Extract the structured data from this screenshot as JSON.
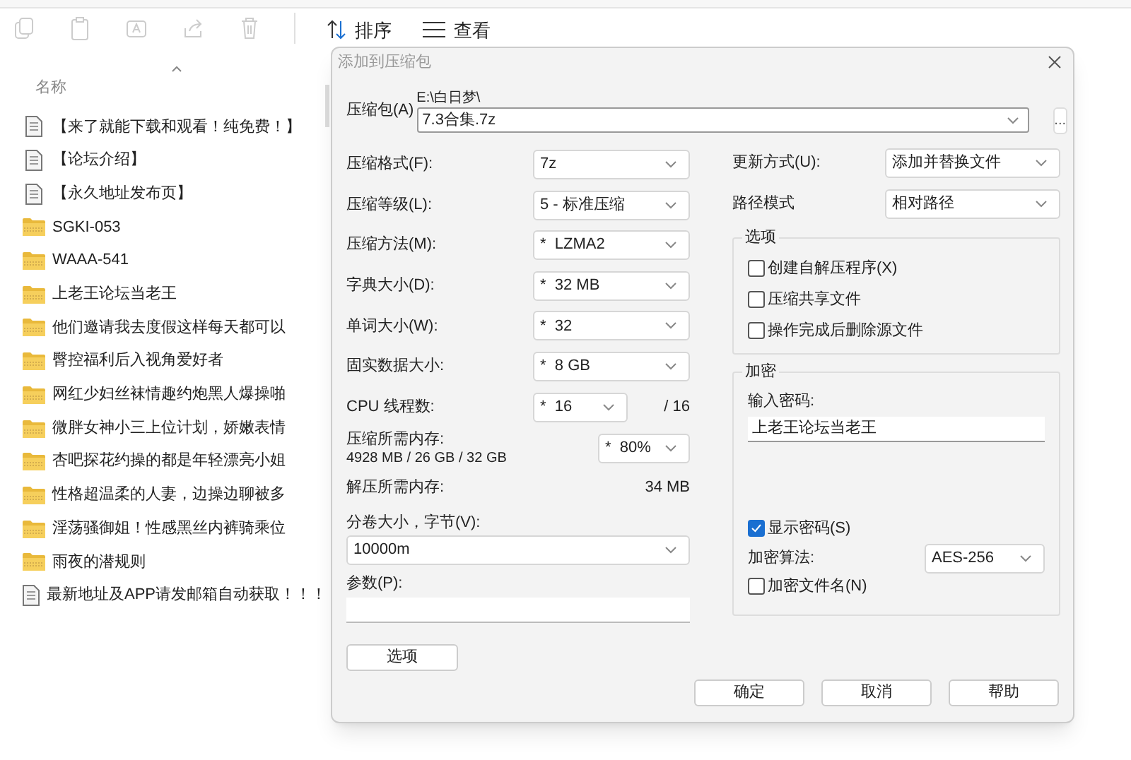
{
  "explorer": {
    "toolbar": [
      {
        "label": "排序"
      },
      {
        "label": "查看"
      }
    ],
    "column_header": "名称",
    "files": [
      {
        "name": "【来了就能下载和观看！纯免费！】",
        "kind": "document"
      },
      {
        "name": "【论坛介绍】",
        "kind": "document"
      },
      {
        "name": "【永久地址发布页】",
        "kind": "document"
      },
      {
        "name": "SGKI-053",
        "kind": "zip"
      },
      {
        "name": "WAAA-541",
        "kind": "zip"
      },
      {
        "name": "上老王论坛当老王",
        "kind": "zip"
      },
      {
        "name": "他们邀请我去度假这样每天都可以",
        "kind": "zip"
      },
      {
        "name": "臀控福利后入视角爱好者",
        "kind": "zip"
      },
      {
        "name": "网红少妇丝袜情趣约炮黑人爆操啪",
        "kind": "zip"
      },
      {
        "name": "微胖女神小三上位计划，娇嫩表情",
        "kind": "zip"
      },
      {
        "name": "杏吧探花约操的都是年轻漂亮小姐",
        "kind": "zip"
      },
      {
        "name": "性格超温柔的人妻，边操边聊被多",
        "kind": "zip"
      },
      {
        "name": "淫荡骚御姐！性感黑丝内裤骑乘位",
        "kind": "zip"
      },
      {
        "name": "雨夜的潜规则",
        "kind": "zip"
      },
      {
        "name": "最新地址及APP请发邮箱自动获取！！！",
        "kind": "document"
      }
    ]
  },
  "dialog": {
    "title": "添加到压缩包",
    "archive": {
      "label": "压缩包(A)",
      "path": "E:\\白日梦\\",
      "value": "7.3合集.7z"
    },
    "browse_button": "...",
    "fields": [
      {
        "label": "压缩格式(F):",
        "value": "7z"
      },
      {
        "label": "压缩等级(L):",
        "value": "5 - 标准压缩"
      },
      {
        "label": "压缩方法(M):",
        "value": "*  LZMA2"
      },
      {
        "label": "字典大小(D):",
        "value": "*  32 MB"
      },
      {
        "label": "单词大小(W):",
        "value": "*  32"
      },
      {
        "label": "固实数据大小:",
        "value": "*  8 GB"
      }
    ],
    "cpu": {
      "label": "CPU 线程数:",
      "value": "*  16",
      "total": "/ 16"
    },
    "memory": {
      "label": "压缩所需内存:",
      "detail": "4928 MB / 26 GB / 32 GB",
      "value": "*  80%"
    },
    "decompress": {
      "label": "解压所需内存:",
      "value": "34 MB"
    },
    "volume": {
      "label": "分卷大小，字节(V):",
      "value": "10000m"
    },
    "params": {
      "label": "参数(P):"
    },
    "options_button": "选项",
    "update": {
      "label": "更新方式(U):",
      "value": "添加并替换文件"
    },
    "path_mode": {
      "label": "路径模式",
      "value": "相对路径"
    },
    "options_group": {
      "title": "选项",
      "items": [
        {
          "label": "创建自解压程序(X)",
          "checked": false
        },
        {
          "label": "压缩共享文件",
          "checked": false
        },
        {
          "label": "操作完成后删除源文件",
          "checked": false
        }
      ]
    },
    "encryption": {
      "title": "加密",
      "password_label": "输入密码:",
      "password": "上老王论坛当老王",
      "show_password": {
        "label": "显示密码(S)",
        "checked": true
      },
      "method_label": "加密算法:",
      "method": "AES-256",
      "encrypt_names": {
        "label": "加密文件名(N)",
        "checked": false
      }
    },
    "buttons": [
      "确定",
      "取消",
      "帮助"
    ]
  }
}
